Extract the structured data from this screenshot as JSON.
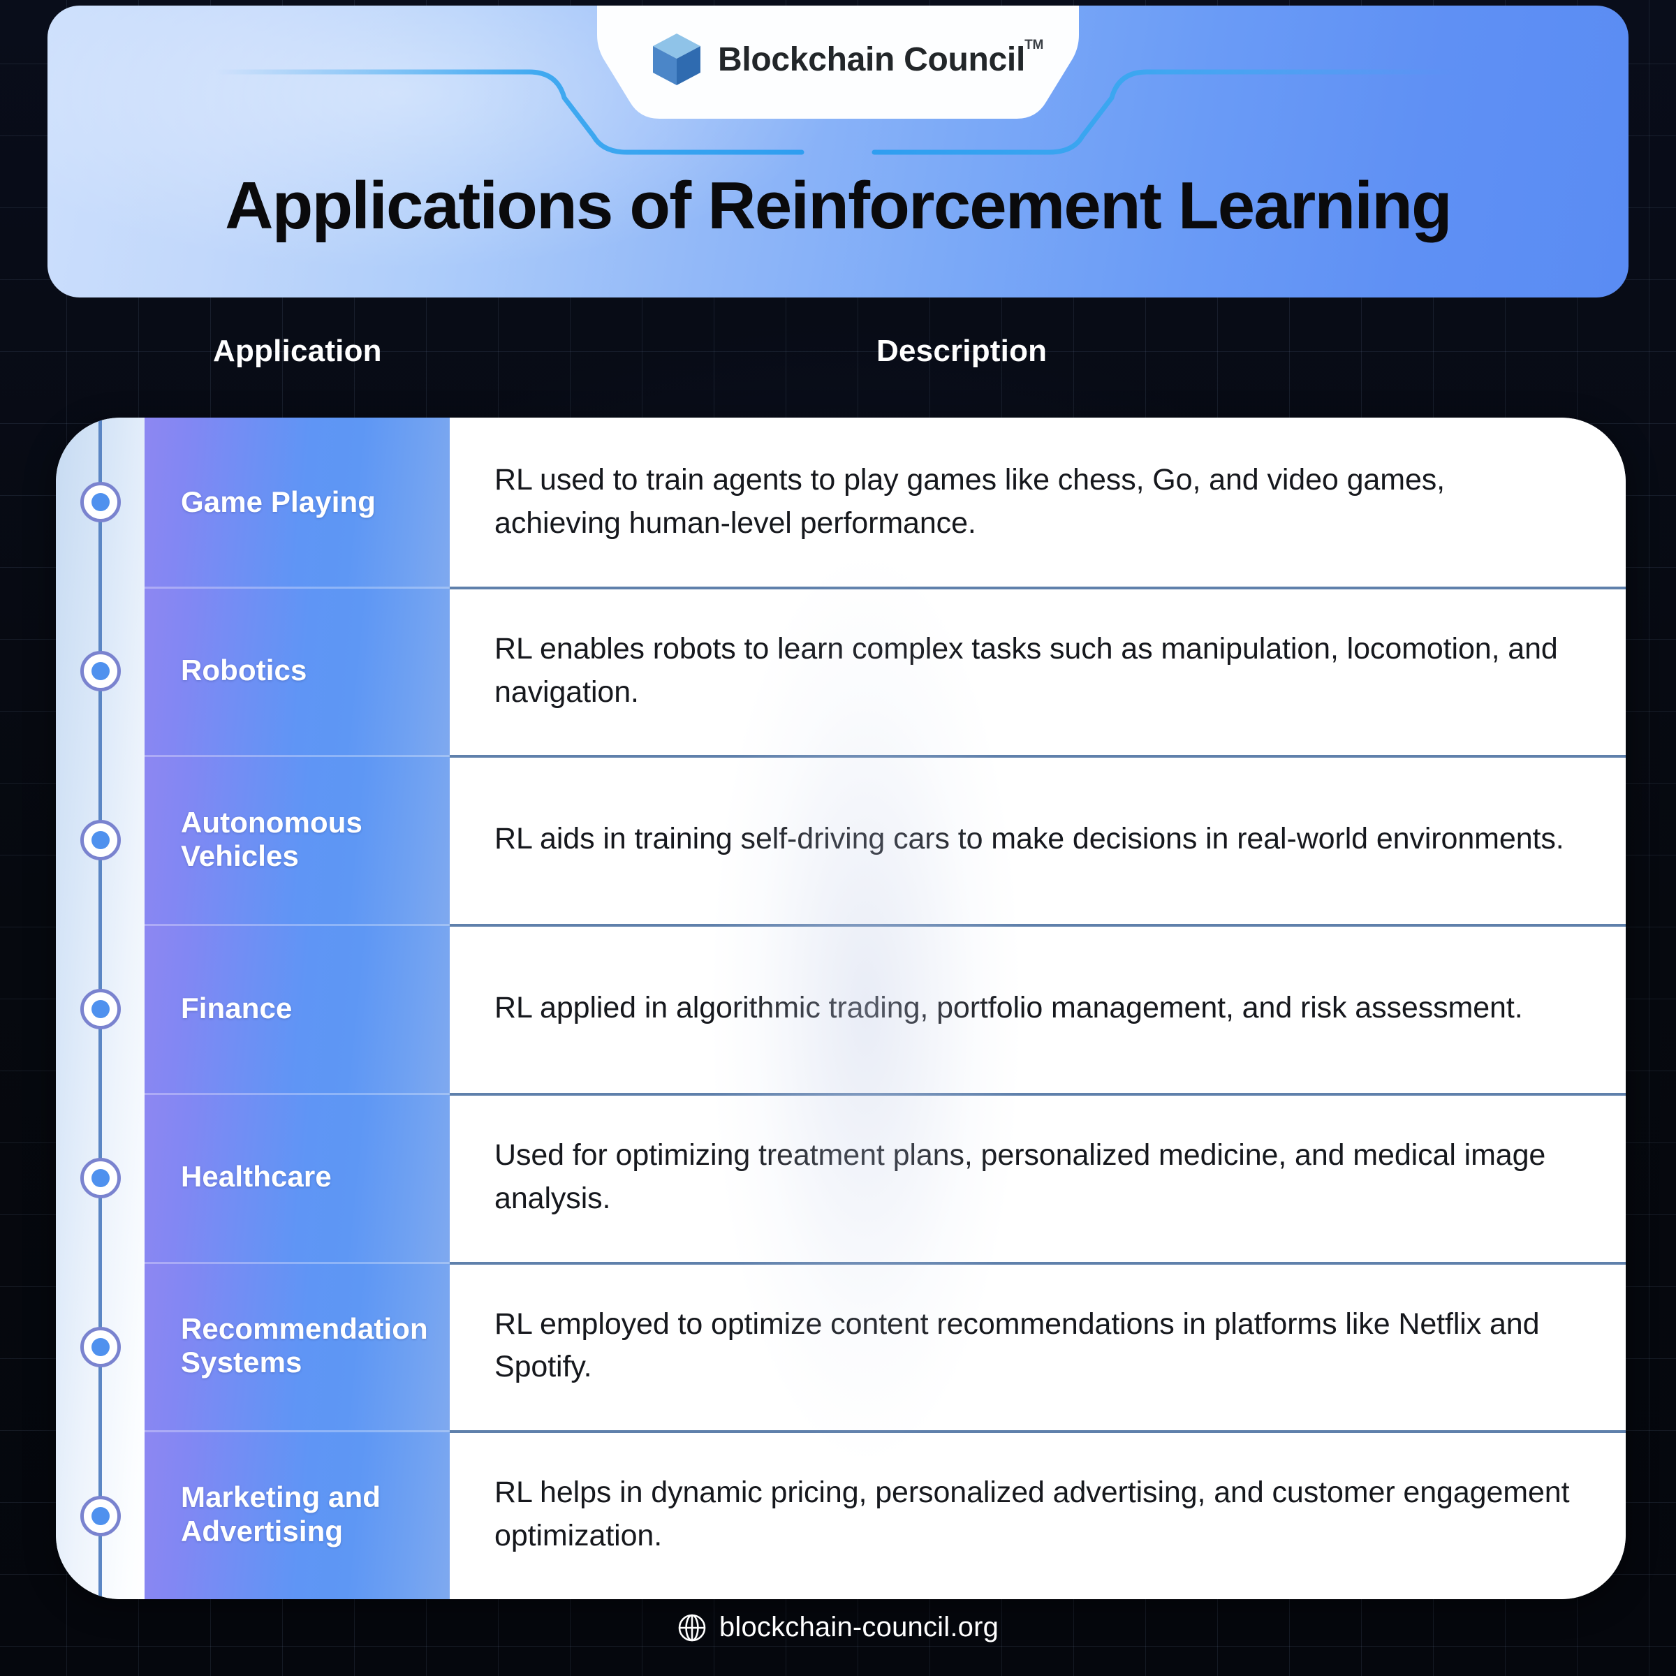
{
  "brand": {
    "name": "Blockchain Council",
    "trademark": "TM",
    "logo_icon": "cube-icon",
    "cube_top_color": "#8fc3e8",
    "cube_left_color": "#4b86c8",
    "cube_right_color": "#2f6bb0"
  },
  "header": {
    "title": "Applications of Reinforcement Learning",
    "gradient_from": "#ccdffc",
    "gradient_to": "#5a8cf3",
    "accent_line_color": "#3aa7f0"
  },
  "table": {
    "columns": [
      "Application",
      "Description"
    ],
    "app_gradient_from": "#8d87f2",
    "app_gradient_to": "#7fa9ef",
    "divider_color": "#5f80ab",
    "marker_icon": "timeline-dot-icon",
    "marker_ring_color": "#7a83cf",
    "marker_dot_color": "#4f91ee",
    "rows": [
      {
        "application": "Game Playing",
        "description": "RL used to train agents to play games like chess, Go, and video games, achieving human-level performance."
      },
      {
        "application": "Robotics",
        "description": "RL enables robots to learn complex tasks such as manipulation, locomotion, and navigation."
      },
      {
        "application": "Autonomous Vehicles",
        "description": "RL aids in training self-driving cars to make decisions in real-world environments."
      },
      {
        "application": "Finance",
        "description": "RL applied in algorithmic trading, portfolio management, and risk assessment."
      },
      {
        "application": "Healthcare",
        "description": "Used for optimizing treatment plans, personalized medicine, and medical image analysis."
      },
      {
        "application": "Recommendation Systems",
        "description": "RL employed to optimize content recommendations in platforms like Netflix and Spotify."
      },
      {
        "application": "Marketing and Advertising",
        "description": "RL helps in dynamic pricing, personalized advertising, and customer engagement optimization."
      }
    ]
  },
  "footer": {
    "icon": "globe-icon",
    "url": "blockchain-council.org"
  },
  "background": {
    "color": "#05070f",
    "grid_line_color": "#20283d"
  }
}
